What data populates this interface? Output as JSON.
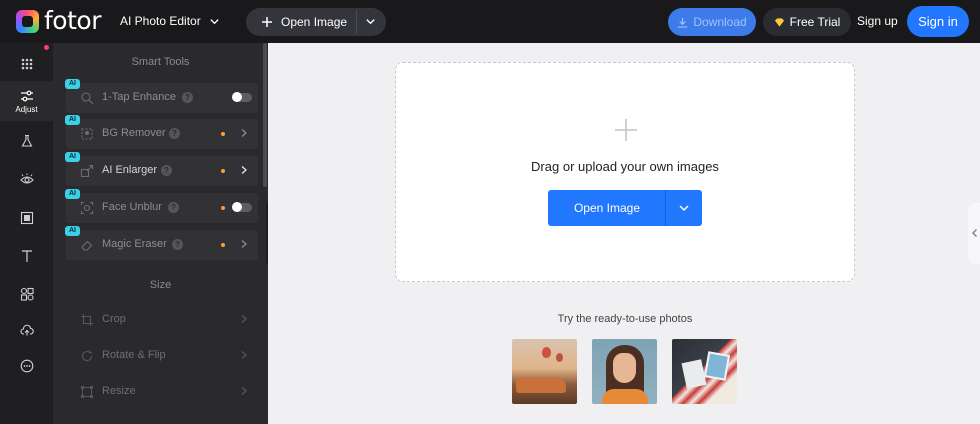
{
  "header": {
    "logo_text": "fotor",
    "mode_label": "AI Photo Editor",
    "open_image_label": "Open Image",
    "download_label": "Download",
    "free_trial_label": "Free Trial",
    "signup_label": "Sign up",
    "signin_label": "Sign in"
  },
  "rail": {
    "items": [
      {
        "name": "templates",
        "icon": "grid-icon",
        "label": ""
      },
      {
        "name": "adjust",
        "icon": "sliders-icon",
        "label": "Adjust",
        "active": true
      },
      {
        "name": "beauty",
        "icon": "flask-icon",
        "label": ""
      },
      {
        "name": "eye",
        "icon": "eye-icon",
        "label": ""
      },
      {
        "name": "frames",
        "icon": "frame-icon",
        "label": ""
      },
      {
        "name": "text",
        "icon": "text-icon",
        "label": ""
      },
      {
        "name": "elements",
        "icon": "shapes-icon",
        "label": ""
      },
      {
        "name": "upload",
        "icon": "cloud-upload-icon",
        "label": ""
      },
      {
        "name": "more",
        "icon": "more-icon",
        "label": ""
      }
    ]
  },
  "panel": {
    "smart_tools_title": "Smart Tools",
    "size_title": "Size",
    "ai_badge": "AI",
    "smart_tools": [
      {
        "label": "1-Tap Enhance",
        "control": "toggle"
      },
      {
        "label": "BG Remover",
        "control": "arrow"
      },
      {
        "label": "AI Enlarger",
        "control": "arrow"
      },
      {
        "label": "Face Unblur",
        "control": "toggle"
      },
      {
        "label": "Magic Eraser",
        "control": "arrow"
      }
    ],
    "size_tools": [
      {
        "label": "Crop"
      },
      {
        "label": "Rotate & Flip"
      },
      {
        "label": "Resize"
      }
    ]
  },
  "main": {
    "drop_text": "Drag or upload your own images",
    "open_image_label": "Open Image",
    "try_text": "Try the ready-to-use photos"
  },
  "colors": {
    "accent": "#2277ff",
    "topbar": "#19191b",
    "panel": "#2a2a2d",
    "ai_badge": "#3ad1e8",
    "dot": "#ff9f2e"
  }
}
